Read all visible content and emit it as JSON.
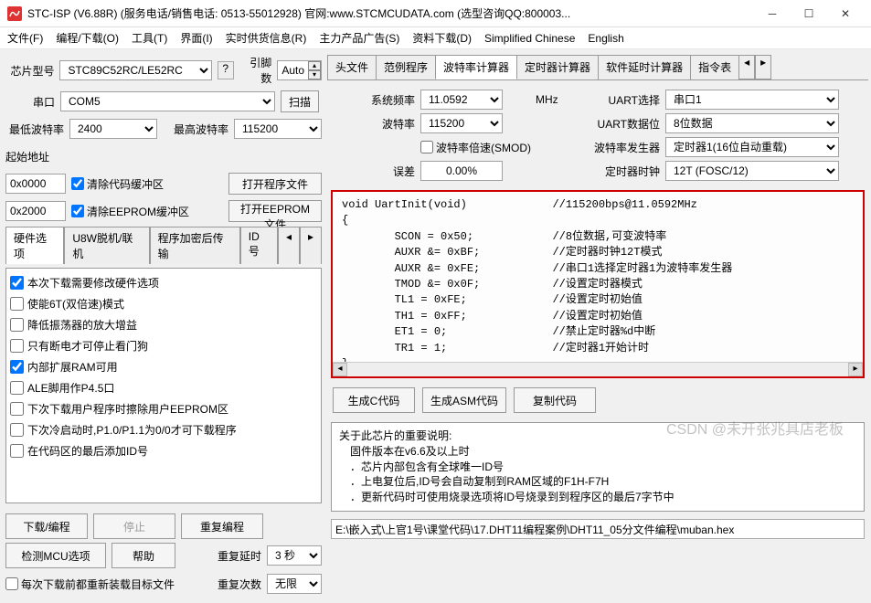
{
  "title": "STC-ISP (V6.88R) (服务电话/销售电话: 0513-55012928) 官网:www.STCMCUDATA.com (选型咨询QQ:800003...",
  "menu": [
    "文件(F)",
    "编程/下载(O)",
    "工具(T)",
    "界面(I)",
    "实时供货信息(R)",
    "主力产品广告(S)",
    "资料下载(D)",
    "Simplified Chinese",
    "English"
  ],
  "left": {
    "chip_lbl": "芯片型号",
    "chip": "STC89C52RC/LE52RC",
    "pin_lbl": "引脚数",
    "pin": "Auto",
    "port_lbl": "串口",
    "port": "COM5",
    "scan_btn": "扫描",
    "minbaud_lbl": "最低波特率",
    "minbaud": "2400",
    "maxbaud_lbl": "最高波特率",
    "maxbaud": "115200",
    "startaddr_lbl": "起始地址",
    "addr_code": "0x0000",
    "clear_code": "清除代码缓冲区",
    "open_code": "打开程序文件",
    "addr_eep": "0x2000",
    "clear_eep": "清除EEPROM缓冲区",
    "open_eep": "打开EEPROM文件",
    "tabs": [
      "硬件选项",
      "U8W脱机/联机",
      "程序加密后传输",
      "ID号"
    ],
    "opts": [
      {
        "c": true,
        "t": "本次下载需要修改硬件选项"
      },
      {
        "c": false,
        "t": "使能6T(双倍速)模式"
      },
      {
        "c": false,
        "t": "降低振荡器的放大增益"
      },
      {
        "c": false,
        "t": "只有断电才可停止看门狗"
      },
      {
        "c": true,
        "t": "内部扩展RAM可用"
      },
      {
        "c": false,
        "t": "ALE脚用作P4.5口"
      },
      {
        "c": false,
        "t": "下次下载用户程序时擦除用户EEPROM区"
      },
      {
        "c": false,
        "t": "下次冷启动时,P1.0/P1.1为0/0才可下载程序"
      },
      {
        "c": false,
        "t": "在代码区的最后添加ID号"
      }
    ],
    "dl": "下载/编程",
    "stop": "停止",
    "redl": "重复编程",
    "detect": "检测MCU选项",
    "help": "帮助",
    "delay_lbl": "重复延时",
    "delay": "3 秒",
    "reload": "每次下载前都重新装载目标文件",
    "repeat_lbl": "重复次数",
    "repeat": "无限"
  },
  "right": {
    "tabs": [
      "头文件",
      "范例程序",
      "波特率计算器",
      "定时器计算器",
      "软件延时计算器",
      "指令表"
    ],
    "active_tab": 2,
    "form": {
      "sysfreq_lbl": "系统频率",
      "sysfreq": "11.0592",
      "sysfreq_unit": "MHz",
      "uart_sel_lbl": "UART选择",
      "uart_sel": "串口1",
      "baud_lbl": "波特率",
      "baud": "115200",
      "databit_lbl": "UART数据位",
      "databit": "8位数据",
      "smod_lbl": "波特率倍速(SMOD)",
      "smod": false,
      "gen_lbl": "波特率发生器",
      "gen": "定时器1(16位自动重载)",
      "err_lbl": "误差",
      "err": "0.00%",
      "tclk_lbl": "定时器时钟",
      "tclk": "12T (FOSC/12)"
    },
    "code": "void UartInit(void)\t\t//115200bps@11.0592MHz\n{\n\tSCON = 0x50;\t\t//8位数据,可变波特率\n\tAUXR &= 0xBF;\t\t//定时器时钟12T模式\n\tAUXR &= 0xFE;\t\t//串口1选择定时器1为波特率发生器\n\tTMOD &= 0x0F;\t\t//设置定时器模式\n\tTL1 = 0xFE;\t\t//设置定时初始值\n\tTH1 = 0xFF;\t\t//设置定时初始值\n\tET1 = 0;\t\t//禁止定时器%d中断\n\tTR1 = 1;\t\t//定时器1开始计时\n}",
    "genc": "生成C代码",
    "genasm": "生成ASM代码",
    "copy": "复制代码",
    "notes_header": "关于此芯片的重要说明:",
    "notes": [
      "固件版本在v6.6及以上时",
      "芯片内部包含有全球唯一ID号",
      "上电复位后,ID号会自动复制到RAM区域的F1H-F7H",
      "更新代码时可使用烧录选项将ID号烧录到到程序区的最后7字节中"
    ],
    "path": "E:\\嵌入式\\上官1号\\课堂代码\\17.DHT11编程案例\\DHT11_05分文件编程\\muban.hex",
    "watermark": "CSDN @未开张兆具店老板"
  }
}
